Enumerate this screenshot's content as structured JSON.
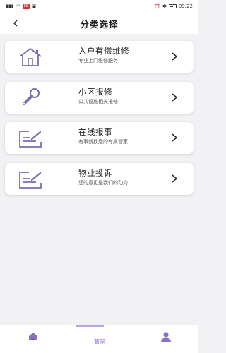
{
  "status_bar": {
    "carrier": "⁴⁶ᵢₗ",
    "badge": "88",
    "time": "09:22"
  },
  "header": {
    "title": "分类选择"
  },
  "cards": [
    {
      "title": "入户有偿维修",
      "subtitle": "专业上门维修服务",
      "icon": "house-icon"
    },
    {
      "title": "小区报修",
      "subtitle": "公共设施相关报修",
      "icon": "wrench-icon"
    },
    {
      "title": "在线报事",
      "subtitle": "有事就找您的专属管家",
      "icon": "form-icon"
    },
    {
      "title": "物业投诉",
      "subtitle": "您的意见是我们的动力",
      "icon": "form-icon"
    }
  ],
  "bottom_nav": {
    "tabs": [
      {
        "label": "",
        "icon": "home-icon"
      },
      {
        "label": "管家",
        "icon": ""
      },
      {
        "label": "",
        "icon": "user-icon"
      }
    ]
  },
  "colors": {
    "accent": "#8a6fc9",
    "background": "#f2f2f4"
  }
}
